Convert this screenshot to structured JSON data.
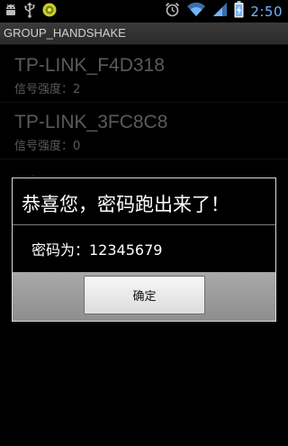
{
  "status_bar": {
    "time": "2:50",
    "icons": [
      "android-debug-icon",
      "usb-icon",
      "notification-icon",
      "alarm-icon",
      "wifi-signal-icon",
      "cell-signal-icon",
      "battery-charging-icon"
    ]
  },
  "app": {
    "title": "GROUP_HANDSHAKE"
  },
  "networks": [
    {
      "ssid": "TP-LINK_F4D318",
      "strength": "信号强度：2"
    },
    {
      "ssid": "TP-LINK_3FC8C8",
      "strength": "信号强度：0"
    }
  ],
  "dialog": {
    "title": "恭喜您，密码跑出来了！",
    "message": "密码为：12345679",
    "ok_label": "确定"
  },
  "colors": {
    "clock": "#6fb6ff",
    "list_text": "#8b8b8b",
    "notification_dot": "#c8d12a"
  }
}
